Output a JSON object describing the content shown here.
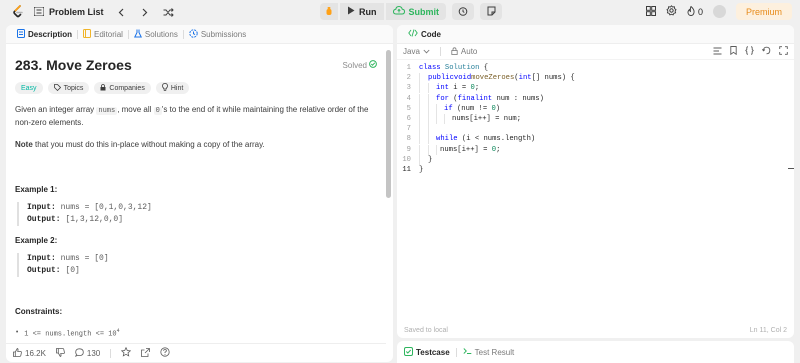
{
  "colors": {
    "accent": "#ffa116",
    "success": "#2db55d",
    "easy": "#00b8a3",
    "premium": "#e78b1a"
  },
  "topbar": {
    "problem_list": "Problem List",
    "run": "Run",
    "submit": "Submit",
    "streak": "0",
    "premium": "Premium"
  },
  "left_tabs": [
    {
      "label": "Description",
      "icon": "document-icon"
    },
    {
      "label": "Editorial",
      "icon": "book-icon"
    },
    {
      "label": "Solutions",
      "icon": "flask-icon"
    },
    {
      "label": "Submissions",
      "icon": "history-icon"
    }
  ],
  "problem": {
    "title": "283. Move Zeroes",
    "solved": "Solved",
    "chips": [
      "Easy",
      "Topics",
      "Companies",
      "Hint"
    ],
    "desc_pre": "Given an integer array ",
    "desc_code1": "nums",
    "desc_mid": ", move all ",
    "desc_code2": "0",
    "desc_post": "'s to the end of it while maintaining the relative order of the non-zero elements.",
    "note_bold": "Note",
    "note_rest": " that you must do this in-place without making a copy of the array.",
    "example1_title": "Example 1:",
    "example1_input_label": "Input:",
    "example1_input": " nums = [0,1,0,3,12]",
    "example1_output_label": "Output:",
    "example1_output": " [1,3,12,0,0]",
    "example2_title": "Example 2:",
    "example2_input_label": "Input:",
    "example2_input": " nums = [0]",
    "example2_output_label": "Output:",
    "example2_output": " [0]",
    "constraints_title": "Constraints:",
    "constraint1": "1 <= nums.length <= 10",
    "constraint1_exp": "4"
  },
  "footer": {
    "likes": "16.2K",
    "comments": "130"
  },
  "code_panel": {
    "tab": "Code",
    "language": "Java",
    "auto": "Auto",
    "saved": "Saved to local",
    "cursor": "Ln 11, Col 2"
  },
  "code_lines": [
    {
      "n": "1"
    },
    {
      "n": "2"
    },
    {
      "n": "3"
    },
    {
      "n": "4"
    },
    {
      "n": "5"
    },
    {
      "n": "6"
    },
    {
      "n": "7"
    },
    {
      "n": "8"
    },
    {
      "n": "9"
    },
    {
      "n": "10"
    },
    {
      "n": "11"
    }
  ],
  "code": {
    "l1a": "class",
    "l1b": " Solution ",
    "l1c": "{",
    "l2a": "public",
    "l2b": "void",
    "l2c": "moveZeroes",
    "l2d": "(",
    "l2e": "int",
    "l2f": "[] nums) {",
    "l3a": "int",
    "l3b": " i = ",
    "l3c": "0",
    "l3d": ";",
    "l4a": "for",
    "l4b": " (",
    "l4c": "final",
    "l4d": "int",
    "l4e": " num : nums)",
    "l5a": "if",
    "l5b": " (num != ",
    "l5c": "0",
    "l5d": ")",
    "l6a": "nums[i++] = num;",
    "l8a": "while",
    "l8b": " (i < nums.length)",
    "l9a": "nums[i++] = ",
    "l9b": "0",
    "l9c": ";",
    "l10a": "}",
    "l11a": "}"
  },
  "bottom_tabs": [
    {
      "label": "Testcase",
      "icon": "checkbox-icon"
    },
    {
      "label": "Test Result",
      "icon": "terminal-icon"
    }
  ]
}
